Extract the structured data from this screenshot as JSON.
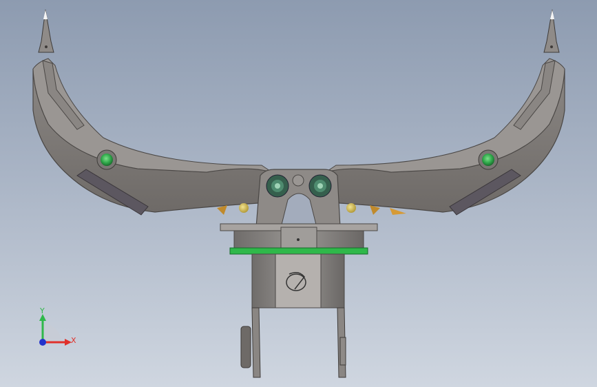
{
  "triad": {
    "x_label": "X",
    "y_label": "Y"
  },
  "colors": {
    "background_top": "#8d9bb0",
    "background_bottom": "#cfd6e0",
    "arm": "#807c78",
    "arm_edge": "#4a4745",
    "pad": "#5c5760",
    "green_ring": "#2fb84a",
    "axis_x": "#e0302a",
    "axis_y": "#2fb84a",
    "axis_z": "#2233cc"
  },
  "icons": [
    "logo-emblem-icon",
    "pivot-bolt-icon",
    "coordinate-triad-icon"
  ]
}
